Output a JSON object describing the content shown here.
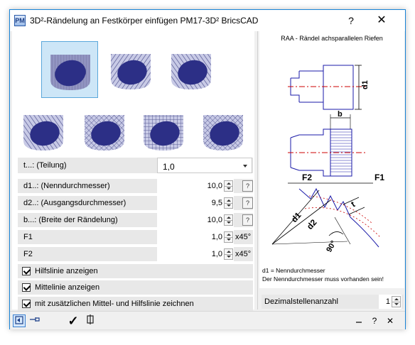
{
  "window": {
    "app_icon": "PM",
    "title": "3D²-Rändelung an Festkörper einfügen  PM17-3D²  BricsCAD",
    "help": "?",
    "close": "✕"
  },
  "params": {
    "teilung": {
      "label": "t...: (Teilung)",
      "value": "1,0"
    },
    "d1": {
      "label": "d1..: (Nenndurchmesser)",
      "value": "10,0"
    },
    "d2": {
      "label": "d2..: (Ausgangsdurchmesser)",
      "value": "9,5"
    },
    "b": {
      "label": "b...: (Breite der Rändelung)",
      "value": "10,0"
    },
    "f1": {
      "label": "F1",
      "value": "1,0",
      "unit": "x45°"
    },
    "f2": {
      "label": "F2",
      "value": "1,0",
      "unit": "x45°"
    }
  },
  "checks": [
    {
      "label": "Hilfslinie anzeigen",
      "checked": true
    },
    {
      "label": "Mittelinie anzeigen",
      "checked": true
    },
    {
      "label": "mit zusätzlichen Mittel- und Hilfslinie zeichnen",
      "checked": true
    }
  ],
  "diagram": {
    "title": "RAA - Rändel achsparallelen Riefen",
    "labels": {
      "d1": "d1",
      "b": "b",
      "F2": "F2",
      "F1": "F1",
      "t": "t",
      "d2": "d2",
      "angle": "90°"
    },
    "note1": "d1 = Nenndurchmesser",
    "note2": "Der Nenndurchmesser muss vorhanden sein!",
    "line_color": "#1a1aa8",
    "center_color": "#cc0000"
  },
  "decimals": {
    "label": "Dezimalstellenanzahl",
    "value": "1"
  },
  "bottom": {
    "ok": "✓",
    "close": "✕",
    "help": "?"
  }
}
